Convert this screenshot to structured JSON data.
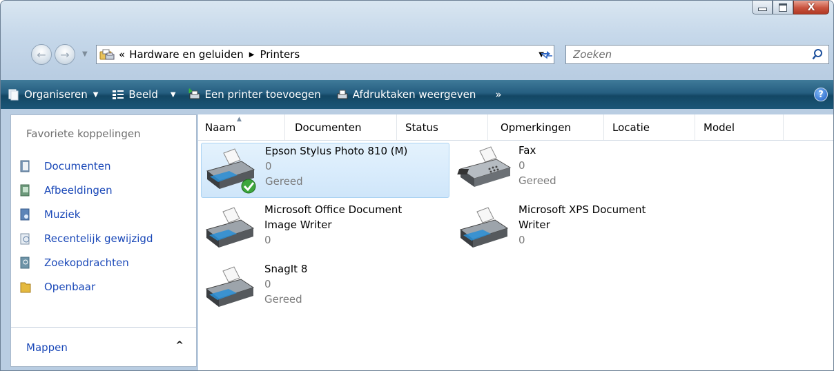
{
  "window": {
    "close_symbol": "X"
  },
  "address": {
    "overflow": "«",
    "crumbs": [
      "Hardware en geluiden",
      "Printers"
    ]
  },
  "search": {
    "placeholder": "Zoeken"
  },
  "toolbar": {
    "organize": "Organiseren",
    "view": "Beeld",
    "add_printer": "Een printer toevoegen",
    "print_jobs": "Afdruktaken weergeven",
    "more": "»",
    "help": "?"
  },
  "sidebar": {
    "header": "Favoriete koppelingen",
    "links": [
      {
        "label": "Documenten",
        "icon": "documents-icon"
      },
      {
        "label": "Afbeeldingen",
        "icon": "pictures-icon"
      },
      {
        "label": "Muziek",
        "icon": "music-icon"
      },
      {
        "label": "Recentelijk gewijzigd",
        "icon": "recent-icon"
      },
      {
        "label": "Zoekopdrachten",
        "icon": "searches-icon"
      },
      {
        "label": "Openbaar",
        "icon": "public-folder-icon"
      }
    ],
    "folders": "Mappen",
    "folders_toggle": "^"
  },
  "columns": [
    "Naam",
    "Documenten",
    "Status",
    "Opmerkingen",
    "Locatie",
    "Model"
  ],
  "printers": [
    {
      "name_lines": [
        "Epson Stylus Photo 810 (M)"
      ],
      "docs": "0",
      "status": "Gereed",
      "default": true,
      "selected": true,
      "icon": "printer-icon"
    },
    {
      "name_lines": [
        "Fax"
      ],
      "docs": "0",
      "status": "Gereed",
      "default": false,
      "selected": false,
      "icon": "fax-icon"
    },
    {
      "name_lines": [
        "Microsoft Office Document",
        "Image Writer"
      ],
      "docs": "0",
      "status": "",
      "default": false,
      "selected": false,
      "icon": "printer-icon"
    },
    {
      "name_lines": [
        "Microsoft XPS Document",
        "Writer"
      ],
      "docs": "0",
      "status": "",
      "default": false,
      "selected": false,
      "icon": "printer-icon"
    },
    {
      "name_lines": [
        "SnagIt 8"
      ],
      "docs": "0",
      "status": "Gereed",
      "default": false,
      "selected": false,
      "icon": "printer-icon"
    }
  ]
}
